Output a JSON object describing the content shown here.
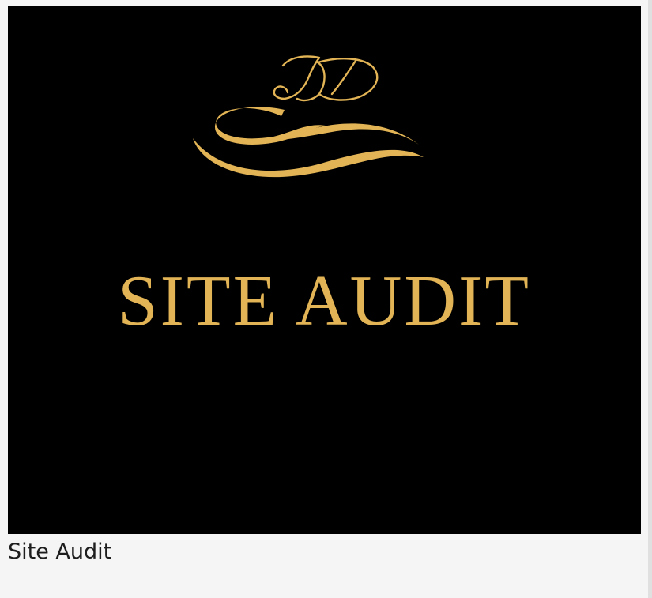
{
  "colors": {
    "gold": "#e2b455",
    "image_background": "#000000",
    "page_background": "#f5f5f5",
    "caption_text": "#1e1e1e"
  },
  "card": {
    "image": {
      "monogram": "JD",
      "headline": "SITE AUDIT",
      "ornament_icon": "swoosh-flourish-icon"
    },
    "caption": "Site Audit"
  }
}
